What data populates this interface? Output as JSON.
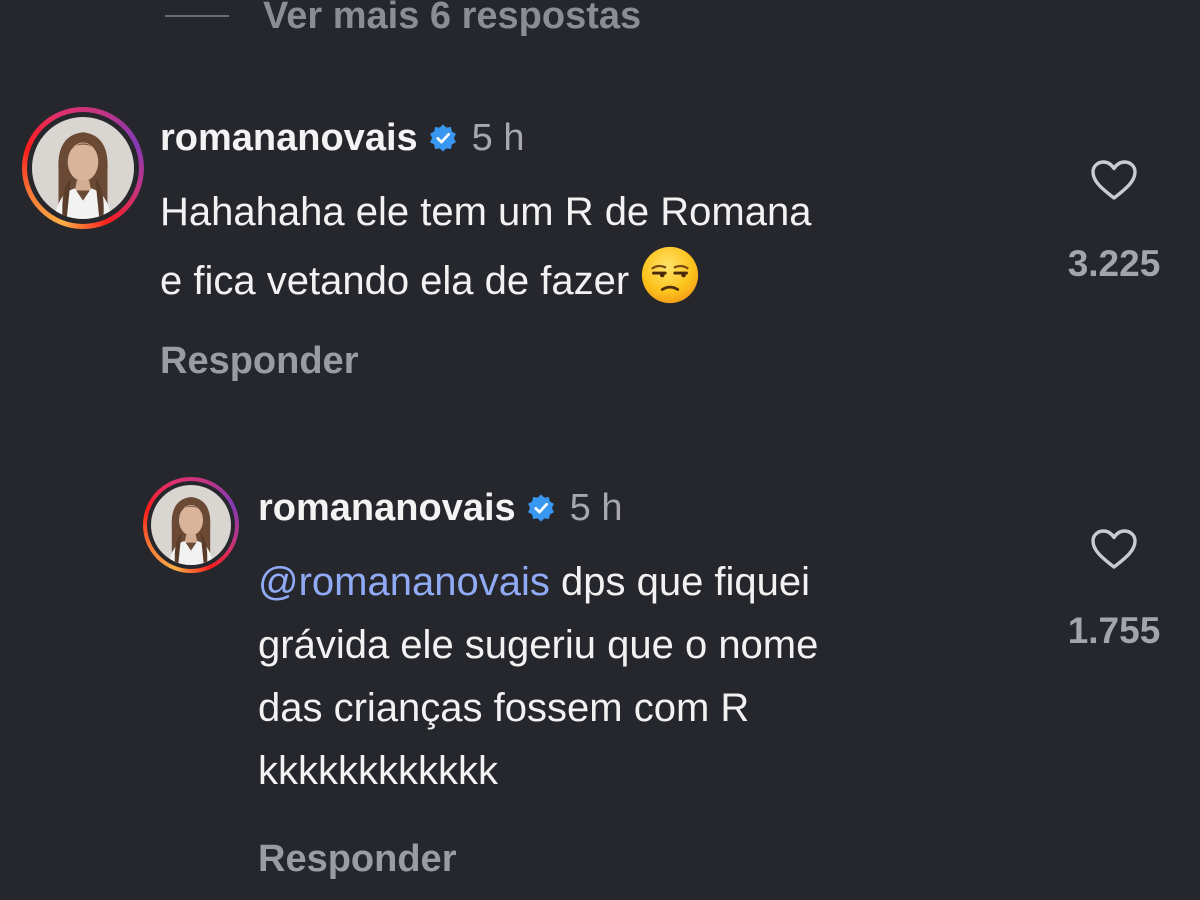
{
  "thread": {
    "view_more_replies": "Ver mais 6 respostas"
  },
  "comments": [
    {
      "username": "romananovais",
      "time": "5 h",
      "mention": "",
      "lines": [
        "Hahahaha ele tem um R de Romana",
        "e fica vetando ela de fazer"
      ],
      "emoji": "unamused-face",
      "likes": "3.225",
      "reply_label": "Responder"
    },
    {
      "username": "romananovais",
      "time": "5 h",
      "mention": "@romananovais",
      "lines": [
        " dps que fiquei",
        "grávida ele sugeriu que o nome",
        "das crianças fossem com R",
        "kkkkkkkkkkkk"
      ],
      "likes": "1.755",
      "reply_label": "Responder"
    }
  ],
  "icons": {
    "verified": "verified-badge-icon",
    "like": "heart-outline-icon",
    "emoji": "unamused-face-emoji"
  },
  "colors": {
    "background": "#26272c",
    "mention": "#90aaf5",
    "verified": "#3897f0",
    "muted": "#a6a8ad"
  }
}
